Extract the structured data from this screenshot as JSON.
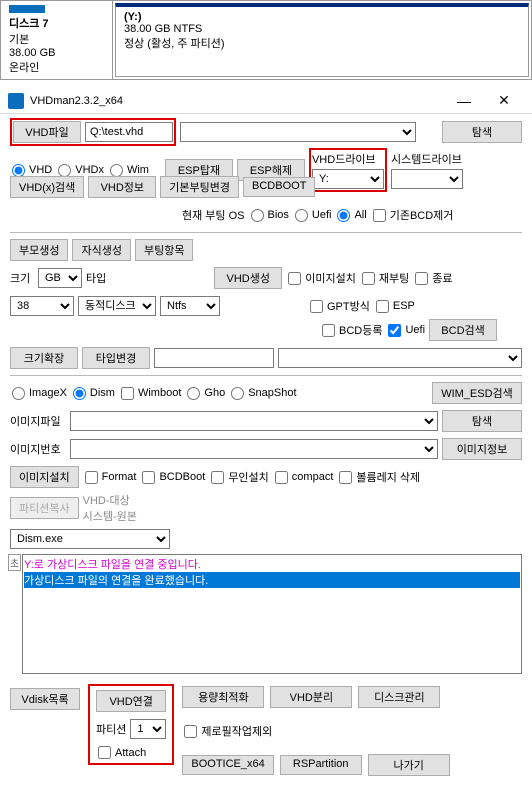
{
  "disk_panel": {
    "name": "디스크 7",
    "type": "기본",
    "size": "38.00 GB",
    "status": "온라인",
    "volume": "(Y:)",
    "vol_size": "38.00 GB NTFS",
    "vol_status": "정상 (활성, 주 파티션)"
  },
  "window": {
    "title": "VHDman2.3.2_x64",
    "minimize": "—",
    "close": "✕"
  },
  "vhd_file": {
    "label": "VHD파일",
    "value": "Q:\\test.vhd",
    "browse": "탐색"
  },
  "vhd_type": {
    "vhd": "VHD",
    "vhdx": "VHDx",
    "wim": "Wim"
  },
  "esp": {
    "install": "ESP탑재",
    "remove": "ESP해제"
  },
  "drive": {
    "label": "VHD드라이브",
    "value": "Y:",
    "system": "시스템드라이브",
    "system_value": ""
  },
  "search": {
    "vhdx": "VHD(x)검색",
    "info": "VHD정보",
    "basic_boot": "기본부팅변경",
    "bcdboot": "BCDBOOT"
  },
  "boot_os": {
    "label": "현재 부팅 OS",
    "bios": "Bios",
    "uefi": "Uefi",
    "all": "All",
    "remove_bcd": "기존BCD제거"
  },
  "gen": {
    "parent": "부모생성",
    "child": "자식생성",
    "boot": "부팅항목"
  },
  "size_row": {
    "label": "크기",
    "unit": "GB",
    "type_label": "타입",
    "create": "VHD생성",
    "img_install": "이미지설치",
    "reboot": "재부팅",
    "exit": "종료"
  },
  "size_row2": {
    "size_val": "38",
    "disk_type": "동적디스크",
    "fs": "Ntfs",
    "gpt": "GPT방식",
    "esp": "ESP",
    "bcd_reg": "BCD등록",
    "uefi": "Uefi",
    "bcd_search": "BCD검색"
  },
  "size_row3": {
    "expand": "크기확장",
    "type_change": "타입변경"
  },
  "imaging": {
    "imagex": "ImageX",
    "dism": "Dism",
    "wimboot": "Wimboot",
    "gho": "Gho",
    "snapshot": "SnapShot",
    "wim_esd": "WIM_ESD검색"
  },
  "img_file": {
    "label": "이미지파일",
    "browse": "탐색"
  },
  "img_no": {
    "label": "이미지번호",
    "info": "이미지정보"
  },
  "img_install2": {
    "install": "이미지설치",
    "format": "Format",
    "bcdboot": "BCDBoot",
    "silent": "무인설치",
    "compact": "compact",
    "vol_delete": "볼륨레지 삭제"
  },
  "partition_copy": {
    "btn": "파티션복사",
    "target": "VHD-대상",
    "source": "시스템-원본"
  },
  "dism_exe": "Dism.exe",
  "log": {
    "line1": "Y:로 가상디스크 파일을 연결 중입니다.",
    "line2": "가상디스크 파일의 연결을 완료했습니다."
  },
  "bottom": {
    "vdisk_list": "Vdisk목록",
    "vhd_connect": "VHD연결",
    "partition": "파티션",
    "partition_val": "1",
    "attach": "Attach",
    "optimize": "용량최적화",
    "exclude_zero": "제로필작업제외",
    "bootice": "BOOTICE_x64",
    "vhd_detach": "VHD분리",
    "rspartition": "RSPartition",
    "disk_mgmt": "디스크관리",
    "exit": "나가기"
  }
}
